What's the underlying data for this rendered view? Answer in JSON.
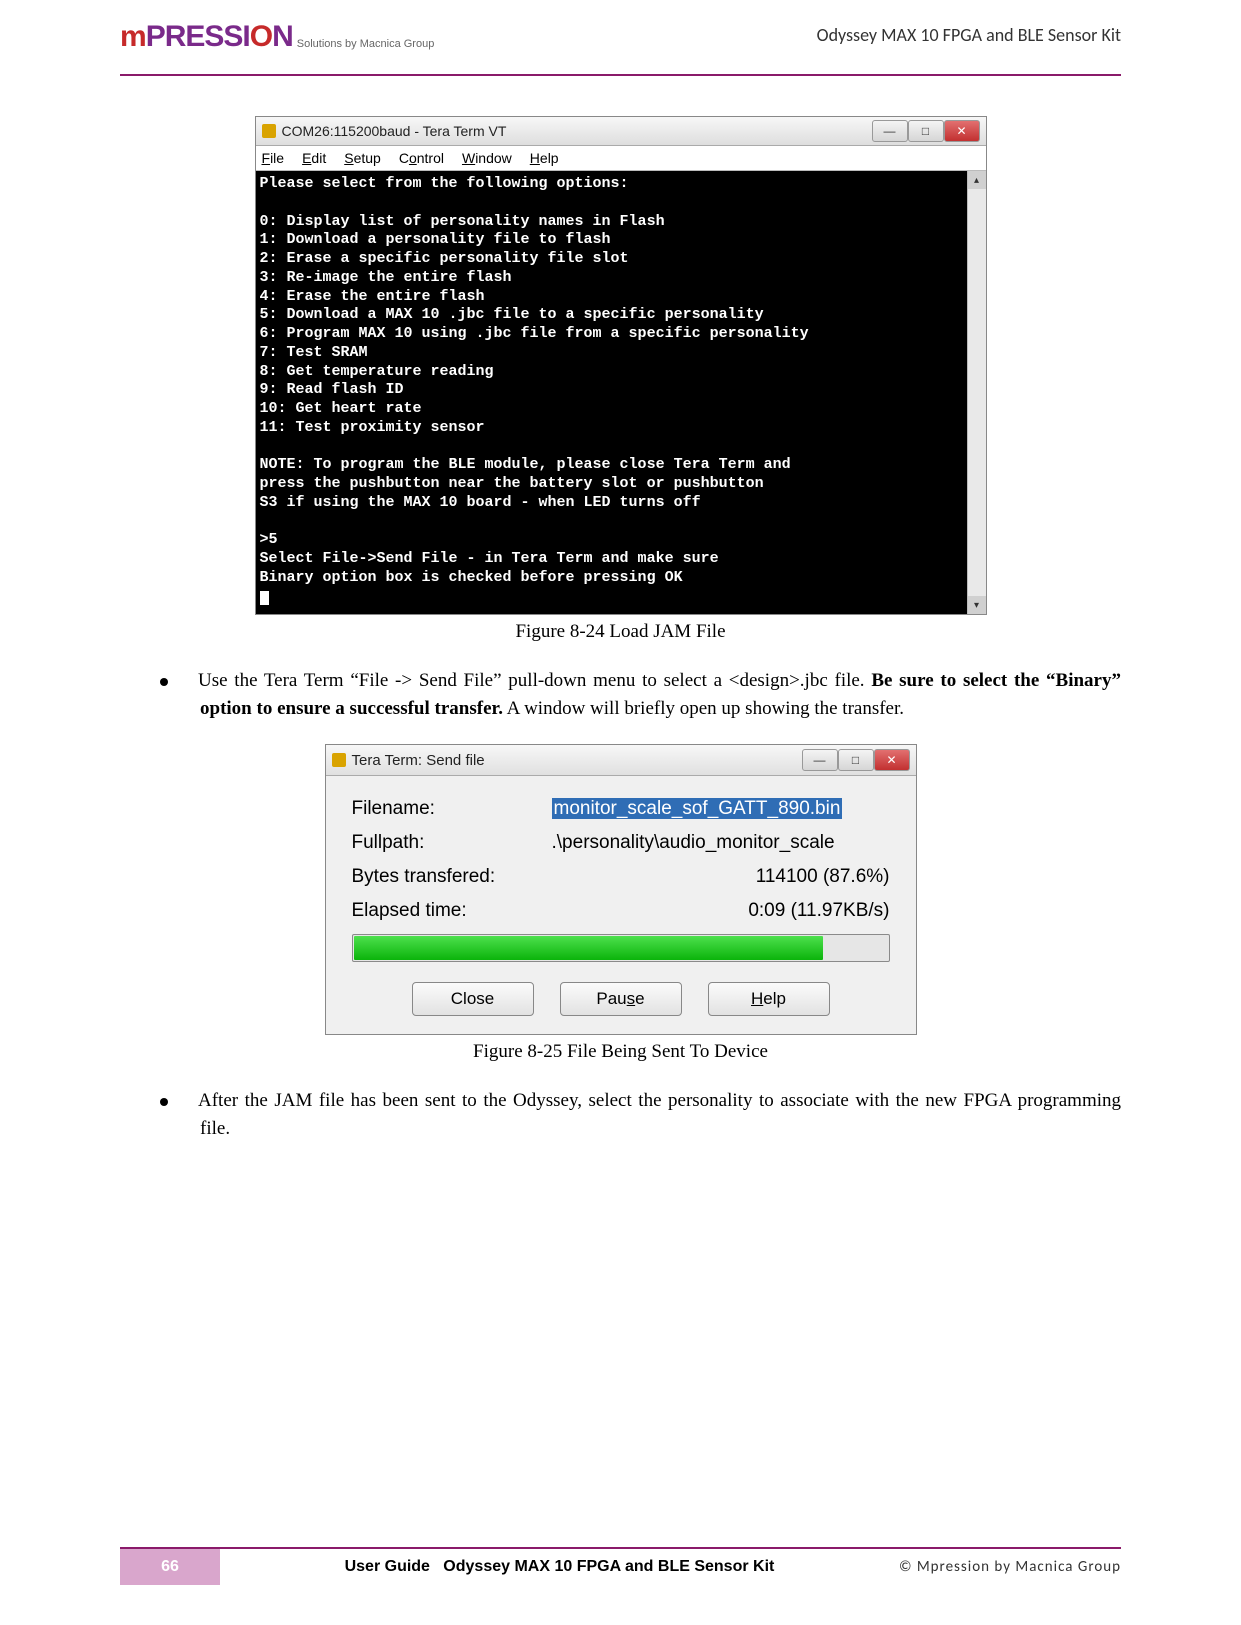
{
  "header": {
    "logo_main_html": "<span class='red'>m</span>PRESSI<span class='red'>O</span>N",
    "logo_sub": "Solutions by Macnica Group",
    "doc_title": "Odyssey MAX 10 FPGA and BLE Sensor Kit"
  },
  "terminal": {
    "title": "COM26:115200baud - Tera Term VT",
    "menu": [
      "File",
      "Edit",
      "Setup",
      "Control",
      "Window",
      "Help"
    ],
    "lines": [
      "Please select from the following options:",
      "",
      "0: Display list of personality names in Flash",
      "1: Download a personality file to flash",
      "2: Erase a specific personality file slot",
      "3: Re-image the entire flash",
      "4: Erase the entire flash",
      "5: Download a MAX 10 .jbc file to a specific personality",
      "6: Program MAX 10 using .jbc file from a specific personality",
      "7: Test SRAM",
      "8: Get temperature reading",
      "9: Read flash ID",
      "10: Get heart rate",
      "11: Test proximity sensor",
      "",
      "NOTE: To program the BLE module, please close Tera Term and",
      "press the pushbutton near the battery slot or pushbutton",
      "S3 if using the MAX 10 board - when LED turns off",
      "",
      ">5",
      "Select File->Send File - in Tera Term and make sure",
      "Binary option box is checked before pressing OK"
    ]
  },
  "caption1": "Figure 8-24 Load JAM File",
  "bullet1": {
    "pre": "Use the Tera Term “File -> Send File” pull-down menu to select a <design>.jbc file. ",
    "bold": "Be sure to select the “Binary” option to ensure a successful transfer.",
    "post": "  A window will briefly open up showing the transfer."
  },
  "dialog": {
    "title": "Tera Term: Send file",
    "filename_label": "Filename:",
    "filename_value": "monitor_scale_sof_GATT_890.bin",
    "fullpath_label": "Fullpath:",
    "fullpath_value": ".\\personality\\audio_monitor_scale",
    "bytes_label": "Bytes transfered:",
    "bytes_value": "114100 (87.6%)",
    "elapsed_label": "Elapsed time:",
    "elapsed_value": "0:09 (11.97KB/s)",
    "progress_percent": 87.6,
    "buttons": {
      "close": "Close",
      "pause": "Pause",
      "help": "Help"
    }
  },
  "caption2": "Figure 8-25 File Being Sent To Device",
  "bullet2": "After the JAM file has been sent to the Odyssey, select the personality to associate with the new FPGA programming file.",
  "footer": {
    "page": "66",
    "mid_bold": "User Guide",
    "mid_rest": "Odyssey MAX 10 FPGA and BLE Sensor Kit",
    "copyright": "©  Mpression  by  Macnica  Group"
  }
}
